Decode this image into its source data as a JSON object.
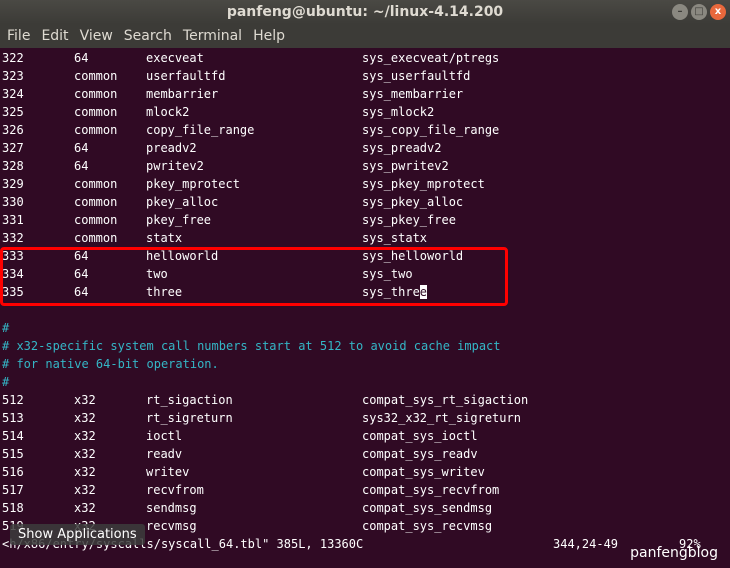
{
  "window": {
    "title": "panfeng@ubuntu: ~/linux-4.14.200"
  },
  "menu": [
    "File",
    "Edit",
    "View",
    "Search",
    "Terminal",
    "Help"
  ],
  "rows_top": [
    [
      "322",
      "64",
      "execveat",
      "sys_execveat/ptregs"
    ],
    [
      "323",
      "common",
      "userfaultfd",
      "sys_userfaultfd"
    ],
    [
      "324",
      "common",
      "membarrier",
      "sys_membarrier"
    ],
    [
      "325",
      "common",
      "mlock2",
      "sys_mlock2"
    ],
    [
      "326",
      "common",
      "copy_file_range",
      "sys_copy_file_range"
    ],
    [
      "327",
      "64",
      "preadv2",
      "sys_preadv2"
    ],
    [
      "328",
      "64",
      "pwritev2",
      "sys_pwritev2"
    ],
    [
      "329",
      "common",
      "pkey_mprotect",
      "sys_pkey_mprotect"
    ],
    [
      "330",
      "common",
      "pkey_alloc",
      "sys_pkey_alloc"
    ],
    [
      "331",
      "common",
      "pkey_free",
      "sys_pkey_free"
    ],
    [
      "332",
      "common",
      "statx",
      "sys_statx"
    ],
    [
      "333",
      "64",
      "helloworld",
      "sys_helloworld"
    ],
    [
      "334",
      "64",
      "two",
      "sys_two"
    ]
  ],
  "row_cursor": {
    "num": "335",
    "abi": "64",
    "name": "three",
    "entry_before": "sys_thre",
    "entry_cursor": "e"
  },
  "comments": [
    "#",
    "# x32-specific system call numbers start at 512 to avoid cache impact",
    "# for native 64-bit operation.",
    "#"
  ],
  "rows_bottom": [
    [
      "512",
      "x32",
      "rt_sigaction",
      "compat_sys_rt_sigaction"
    ],
    [
      "513",
      "x32",
      "rt_sigreturn",
      "sys32_x32_rt_sigreturn"
    ],
    [
      "514",
      "x32",
      "ioctl",
      "compat_sys_ioctl"
    ],
    [
      "515",
      "x32",
      "readv",
      "compat_sys_readv"
    ],
    [
      "516",
      "x32",
      "writev",
      "compat_sys_writev"
    ],
    [
      "517",
      "x32",
      "recvfrom",
      "compat_sys_recvfrom"
    ],
    [
      "518",
      "x32",
      "sendmsg",
      "compat_sys_sendmsg"
    ],
    [
      "519",
      "x32",
      "recvmsg",
      "compat_sys_recvmsg"
    ]
  ],
  "status": {
    "file": "<h/x86/entry/syscalls/syscall_64.tbl\" 385L, 13360C",
    "position": "344,24-49",
    "percent": "92%"
  },
  "tooltip": "Show Applications",
  "watermark": "panfengblog",
  "colors": {
    "background": "#300a24",
    "comment": "#34b6c6",
    "highlight_box": "#ff0000"
  }
}
